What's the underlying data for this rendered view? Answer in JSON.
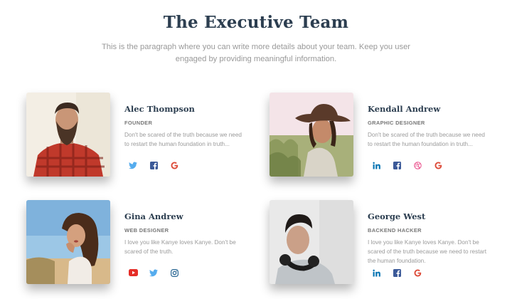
{
  "header": {
    "title": "The Executive Team",
    "description": "This is the paragraph where you can write more details about your team. Keep you user engaged by providing meaningful information."
  },
  "members": [
    {
      "name": "Alec Thompson",
      "role": "FOUNDER",
      "bio": "Don't be scared of the truth because we need to restart the human foundation in truth...",
      "socials": [
        "twitter",
        "facebook",
        "google"
      ]
    },
    {
      "name": "Kendall Andrew",
      "role": "GRAPHIC DESIGNER",
      "bio": "Don't be scared of the truth because we need to restart the human foundation in truth...",
      "socials": [
        "linkedin",
        "facebook",
        "dribbble",
        "google"
      ]
    },
    {
      "name": "Gina Andrew",
      "role": "WEB DESIGNER",
      "bio": "I love you like Kanye loves Kanye. Don't be scared of the truth.",
      "socials": [
        "youtube",
        "twitter",
        "instagram"
      ]
    },
    {
      "name": "George West",
      "role": "BACKEND HACKER",
      "bio": "I love you like Kanye loves Kanye. Don't be scared of the truth because we need to restart the human foundation.",
      "socials": [
        "linkedin",
        "facebook",
        "google"
      ]
    }
  ],
  "colors": {
    "twitter": "#55acee",
    "facebook": "#3b5998",
    "google": "#dd4b39",
    "linkedin": "#0976b4",
    "dribbble": "#ea4c89",
    "youtube": "#e52d27",
    "instagram": "#125688"
  }
}
